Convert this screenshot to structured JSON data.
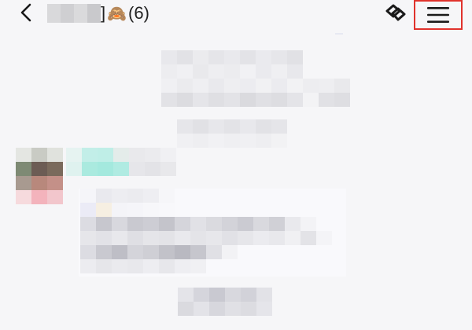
{
  "header": {
    "title_bracket": "]",
    "title_emoji": "🙈",
    "member_count": "(6)",
    "back_icon": "chevron-left-icon",
    "link_icon": "link-icon",
    "menu_icon": "hamburger-menu-icon"
  },
  "colors": {
    "background": "#f6f6f8",
    "highlight_border": "#e0322c",
    "text": "#222222"
  }
}
